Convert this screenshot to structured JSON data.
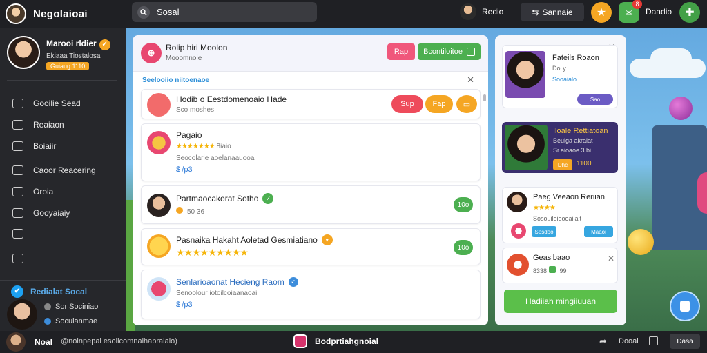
{
  "app": {
    "title": "Negolaioai"
  },
  "search": {
    "value": "Sosal"
  },
  "header": {
    "user_name": "Redio",
    "button_label": "Sannaie",
    "badge_count": "8",
    "right_label": "Daadio"
  },
  "sidebar": {
    "profile": {
      "name": "Marooi rldier",
      "subtitle": "Ekiaaa Tiostalosa",
      "pill": "Guiaug 1110"
    },
    "items": [
      {
        "label": "Gooilie Sead",
        "icon": "inbox-icon"
      },
      {
        "label": "Reaiaon",
        "icon": "chat-icon"
      },
      {
        "label": "Boiaiir",
        "icon": "search-icon"
      },
      {
        "label": "Caoor Reacering",
        "icon": "card-icon"
      },
      {
        "label": "Oroia",
        "icon": "store-icon"
      },
      {
        "label": "Gooyaiaiy",
        "icon": "grid-icon"
      }
    ],
    "social": {
      "title": "Redialat Socal",
      "line1": "Sor Sociniao",
      "line2": "Soculanmae"
    }
  },
  "main": {
    "header": {
      "title": "Rolip hiri Moolon",
      "subtitle": "Mooomnoie",
      "btn_sup": "Rap",
      "btn_green": "Bcontiloitoe"
    },
    "notice": "Seelooiio niitoenaoe",
    "items": [
      {
        "title": "Hodib o Eestdomenoaio Hade",
        "subtitle": "Sco moshes",
        "btn_red": "Sup",
        "btn_orange": "Fap"
      },
      {
        "title": "Pagaio",
        "rating": "★★★★★★★",
        "rating_note": "8iaio",
        "subtitle": "Seocolarie aoelanaauooa",
        "price": "$ /p3"
      },
      {
        "title": "Partmaocakorat Sotho",
        "subtitle": "50 36",
        "badge": "10o"
      },
      {
        "title": "Pasnaika Hakaht Aoletad Gesmiatiano",
        "rating": "★★★★★★★★★",
        "badge": "10o"
      },
      {
        "title": "Senlarioaonat Hecieng Raom",
        "subtitle": "Senoolour iotoilcoiaanaoai",
        "price": "$ /p3"
      }
    ]
  },
  "right": {
    "cards": [
      {
        "title": "Fateils Roaon",
        "sub": "Doi y",
        "link": "Sooaialo",
        "pill": "Sao"
      },
      {
        "title": "Iloale Rettiatoan",
        "sub": "Beuiga akraiat",
        "sub2": "Sr.aioaoe 3 bi",
        "pill": "Dhc",
        "value": "1100"
      },
      {
        "title": "Paeg Veeaon Reriian",
        "stars": "★★★★",
        "sub": "Sosouiloiooeaiialt",
        "pill1": "Spsdoo",
        "pill2": "Maaoi"
      },
      {
        "title": "Geasibaao",
        "sub": "8338",
        "sub2": "99"
      }
    ],
    "cta": "Hadiiah mingiiuuan"
  },
  "footer": {
    "name": "Noal",
    "handle": "@noinpepal esolicomnalhabraialo)",
    "center": "Bodprtiahgnoial",
    "label": "Dooai",
    "button": "Dasa"
  }
}
